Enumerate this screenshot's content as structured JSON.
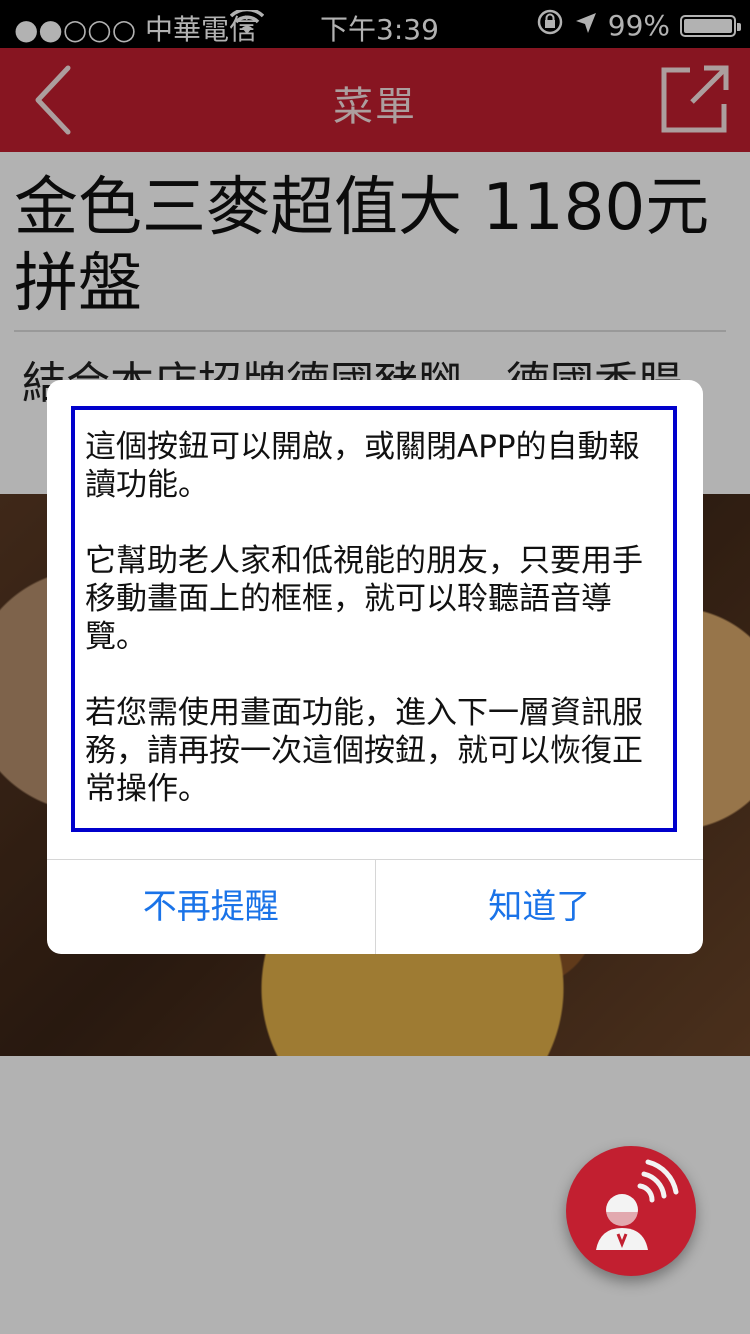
{
  "status_bar": {
    "carrier": "●●○○○ 中華電信",
    "time": "下午3:39",
    "battery_text": "99%",
    "battery_level": 0.99,
    "icons": [
      "wifi-icon",
      "rotation-lock-icon",
      "location-arrow-icon",
      "battery-icon"
    ]
  },
  "nav": {
    "title": "菜單",
    "back_icon": "chevron-left-icon",
    "share_icon": "share-external-icon",
    "color": "#c21f30"
  },
  "item": {
    "title": "金色三麥超值大 1180元 拼盤",
    "description": "結合本店招牌德國豬腳、德國香腸、"
  },
  "dialog": {
    "paragraphs": [
      "這個按鈕可以開啟，或關閉APP的自動報讀功能。",
      "它幫助老人家和低視能的朋友，只要用手移動畫面上的框框，就可以聆聽語音導覽。",
      "若您需使用畫面功能，進入下一層資訊服務，請再按一次這個按鈕，就可以恢復正常操作。"
    ],
    "dismiss_label": "不再提醒",
    "ok_label": "知道了",
    "button_color": "#1a73e8",
    "highlight_color": "#0000cc"
  },
  "fab": {
    "icon": "voice-guide-icon",
    "color": "#c21f30"
  }
}
